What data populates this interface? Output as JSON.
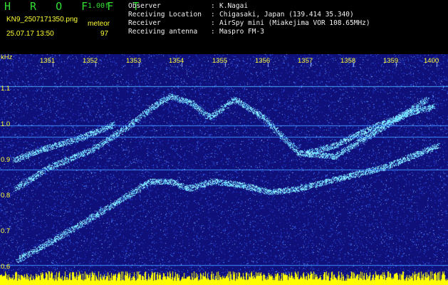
{
  "header": {
    "brand": "H R O F F T",
    "version": "1.00f",
    "filename": "KN9_2507171350.png",
    "datetime": "25.07.17 13:50",
    "meteor_label": "meteor",
    "meteor_count": "97",
    "info": [
      {
        "label": "Observer",
        "sep": ":",
        "value": "K.Nagai"
      },
      {
        "label": "Receiving Location",
        "sep": ":",
        "value": "Chigasaki, Japan (139.414 35.340)"
      },
      {
        "label": "Receiver",
        "sep": ":",
        "value": "AirSpy mini (Miakejima VOR 108.65MHz)"
      },
      {
        "label": "Receiving antenna",
        "sep": ":",
        "value": "Maspro FM-3"
      }
    ]
  },
  "spectrogram": {
    "y_unit": "kHz",
    "y_ticks": [
      "1.1",
      "1.0",
      "0.9",
      "0.8",
      "0.7",
      "0.6"
    ],
    "x_ticks": [
      "1351",
      "1352",
      "1353",
      "1354",
      "1355",
      "1356",
      "1357",
      "1358",
      "1359",
      "1400"
    ],
    "colors": {
      "background": "#10107a",
      "noise": "#3a6aff",
      "signal": "#66e6ff",
      "level_bar": "#ffff00",
      "label": "#ffff33"
    }
  }
}
